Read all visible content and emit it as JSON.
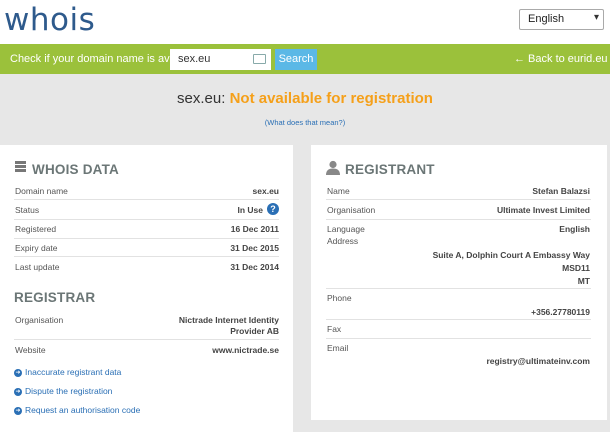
{
  "header": {
    "logo": "whois",
    "language_selected": "English",
    "language_chevron": "▾"
  },
  "search_bar": {
    "prompt": "Check if your domain name is available",
    "input_value": "sex.eu",
    "button_label": "Search",
    "back_link": "← Back to eurid.eu"
  },
  "result": {
    "domain": "sex.eu:",
    "status": "Not available for registration",
    "explain_link": "(What does that mean?)",
    "status_color": "#f5a01a"
  },
  "whois": {
    "title": "WHOIS DATA",
    "icon": "database-icon",
    "rows": [
      {
        "label": "Domain name",
        "value": "sex.eu"
      },
      {
        "label": "Status",
        "value": "In Use"
      },
      {
        "label": "Registered",
        "value": "16 Dec 2011"
      },
      {
        "label": "Expiry date",
        "value": "31 Dec 2015"
      },
      {
        "label": "Last update",
        "value": "31 Dec 2014"
      }
    ],
    "help_glyph": "?"
  },
  "registrar": {
    "title": "REGISTRAR",
    "org_label": "Organisation",
    "org_line1": "Nictrade Internet Identity",
    "org_line2": "Provider AB",
    "website_label": "Website",
    "website_value": "www.nictrade.se",
    "actions": [
      {
        "label": "Inaccurate registrant data",
        "icon": "arrow-circle-icon"
      },
      {
        "label": "Dispute the registration",
        "icon": "arrow-circle-icon"
      },
      {
        "label": "Request an authorisation code",
        "icon": "arrow-circle-icon"
      }
    ]
  },
  "registrant": {
    "title": "REGISTRANT",
    "icon": "user-icon",
    "name_label": "Name",
    "name_value": "Stefan Balazsi",
    "org_label": "Organisation",
    "org_value": "Ultimate Invest Limited",
    "language_label": "Language",
    "language_value": "English",
    "address_label": "Address",
    "address_line1": "Suite A, Dolphin Court A Embassy Way",
    "address_line2": "MSD11",
    "address_line3": "MT",
    "phone_label": "Phone",
    "phone_value": "+356.27780119",
    "fax_label": "Fax",
    "email_label": "Email",
    "email_value": "registry@ultimateinv.com"
  },
  "colors": {
    "brand_green": "#9bc13b",
    "link_blue": "#2a6fb5",
    "search_button": "#5bb8e6"
  }
}
